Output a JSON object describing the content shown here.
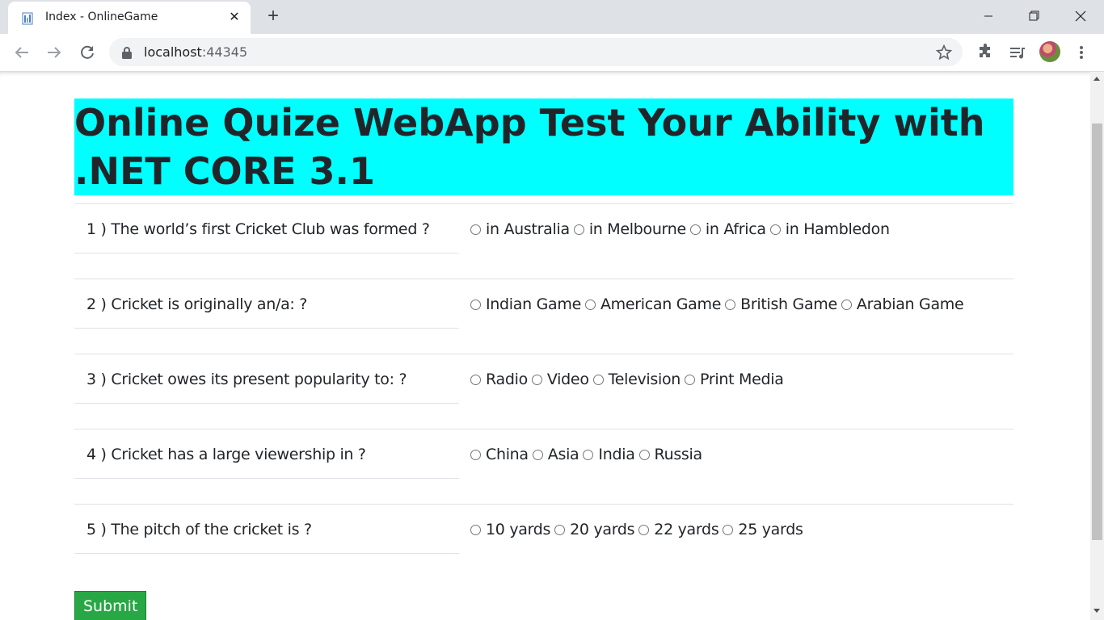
{
  "browser": {
    "tab_title": "Index - OnlineGame",
    "url_host": "localhost",
    "url_port": ":44345"
  },
  "page": {
    "heading": "Online Quize WebApp Test Your Ability with .NET CORE 3.1",
    "submit_label": "Submit",
    "questions": [
      {
        "text": "1 ) The world’s first Cricket Club was formed ?",
        "options": [
          "in Australia",
          "in Melbourne",
          "in Africa",
          "in Hambledon"
        ]
      },
      {
        "text": "2 ) Cricket is originally an/a: ?",
        "options": [
          "Indian Game",
          "American Game",
          "British Game",
          "Arabian Game"
        ]
      },
      {
        "text": "3 ) Cricket owes its present popularity to: ?",
        "options": [
          "Radio",
          "Video",
          "Television",
          "Print Media"
        ]
      },
      {
        "text": "4 ) Cricket has a large viewership in ?",
        "options": [
          "China",
          "Asia",
          "India",
          "Russia"
        ]
      },
      {
        "text": "5 ) The pitch of the cricket is ?",
        "options": [
          "10 yards",
          "20 yards",
          "22 yards",
          "25 yards"
        ]
      }
    ]
  },
  "colors": {
    "banner_bg": "#00ffff",
    "submit_bg": "#28a745"
  }
}
